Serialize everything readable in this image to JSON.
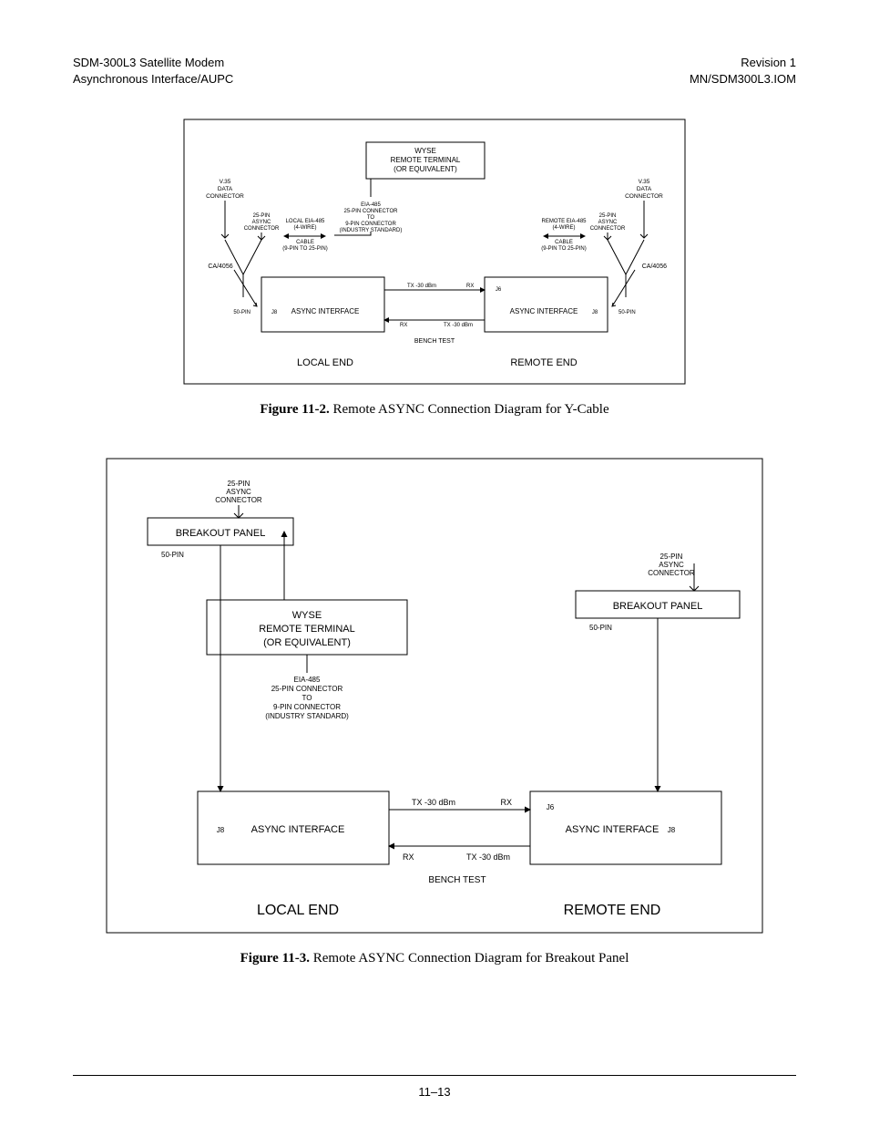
{
  "header": {
    "left1": "SDM-300L3 Satellite Modem",
    "left2": "Asynchronous Interface/AUPC",
    "right1": "Revision 1",
    "right2": "MN/SDM300L3.IOM"
  },
  "fig1": {
    "caption_num": "Figure 11-2.",
    "caption_text": "Remote ASYNC Connection Diagram for Y-Cable",
    "wyse1": "WYSE",
    "wyse2": "REMOTE TERMINAL",
    "wyse3": "(OR EQUIVALENT)",
    "v35_1": "V.35",
    "v35_2": "DATA",
    "v35_3": "CONNECTOR",
    "pin25_1": "25-PIN",
    "pin25_2": "ASYNC",
    "pin25_3": "CONNECTOR",
    "local_eia": "LOCAL EIA-485",
    "remote_eia": "REMOTE EIA-485",
    "wire4": "(4-WIRE)",
    "eia_1": "EIA-485",
    "eia_2": "25-PIN CONNECTOR",
    "eia_3": "TO",
    "eia_4": "9-PIN CONNECTOR",
    "eia_5": "(INDUSTRY STANDARD)",
    "cable_1": "CABLE",
    "cable_2": "(9-PIN TO 25-PIN)",
    "ca4056": "CA/4056",
    "pin50": "50-PIN",
    "j8": "J8",
    "j6": "J6",
    "async_if": "ASYNC INTERFACE",
    "tx": "TX -30 dBm",
    "rx": "RX",
    "bench": "BENCH TEST",
    "local_end": "LOCAL END",
    "remote_end": "REMOTE END"
  },
  "fig2": {
    "caption_num": "Figure 11-3.",
    "caption_text": "Remote ASYNC Connection Diagram for Breakout Panel",
    "pin25_1": "25-PIN",
    "pin25_2": "ASYNC",
    "pin25_3": "CONNECTOR",
    "breakout": "BREAKOUT PANEL",
    "pin50": "50-PIN",
    "wyse1": "WYSE",
    "wyse2": "REMOTE TERMINAL",
    "wyse3": "(OR EQUIVALENT)",
    "eia_1": "EIA-485",
    "eia_2": "25-PIN CONNECTOR",
    "eia_3": "TO",
    "eia_4": "9-PIN CONNECTOR",
    "eia_5": "(INDUSTRY STANDARD)",
    "j8": "J8",
    "j6": "J6",
    "async_if": "ASYNC INTERFACE",
    "tx": "TX -30 dBm",
    "rx": "RX",
    "bench": "BENCH TEST",
    "local_end": "LOCAL END",
    "remote_end": "REMOTE END"
  },
  "footer": {
    "page": "11–13"
  }
}
